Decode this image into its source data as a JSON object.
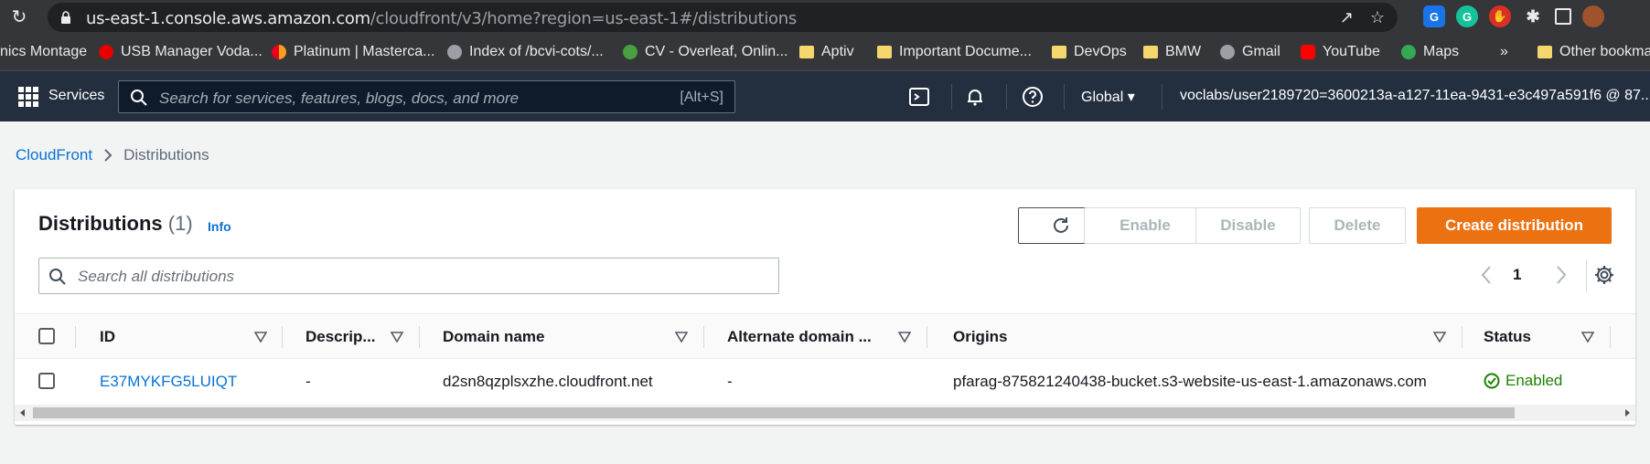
{
  "browser": {
    "url_host": "us-east-1.console.aws.amazon.com",
    "url_path": "/cloudfront/v3/home?region=us-east-1#/distributions",
    "bookmarks": [
      {
        "label": "nics Montage"
      },
      {
        "label": "USB Manager Voda..."
      },
      {
        "label": "Platinum | Masterca..."
      },
      {
        "label": "Index of /bcvi-cots/..."
      },
      {
        "label": "CV - Overleaf, Onlin..."
      },
      {
        "label": "Aptiv"
      },
      {
        "label": "Important Docume..."
      },
      {
        "label": "DevOps"
      },
      {
        "label": "BMW"
      },
      {
        "label": "Gmail"
      },
      {
        "label": "YouTube"
      },
      {
        "label": "Maps"
      },
      {
        "label": "»"
      },
      {
        "label": "Other bookmarks"
      }
    ]
  },
  "aws_nav": {
    "services": "Services",
    "search_placeholder": "Search for services, features, blogs, docs, and more",
    "search_shortcut": "[Alt+S]",
    "region": "Global",
    "account": "voclabs/user2189720=3600213a-a127-11ea-9431-e3c497a591f6 @ 87..."
  },
  "breadcrumb": {
    "root": "CloudFront",
    "current": "Distributions"
  },
  "panel": {
    "title": "Distributions",
    "count": "(1)",
    "info": "Info",
    "enable": "Enable",
    "disable": "Disable",
    "delete": "Delete",
    "create": "Create distribution",
    "search_placeholder": "Search all distributions",
    "page": "1"
  },
  "table": {
    "columns": [
      "ID",
      "Descrip...",
      "Domain name",
      "Alternate domain ...",
      "Origins",
      "Status"
    ],
    "rows": [
      {
        "id": "E37MYKFG5LUIQT",
        "description": "-",
        "domain": "d2sn8qzplsxzhe.cloudfront.net",
        "alternate": "-",
        "origins": "pfarag-875821240438-bucket.s3-website-us-east-1.amazonaws.com",
        "status": "Enabled"
      }
    ]
  },
  "colors": {
    "aws_nav": "#232f3e",
    "link": "#0972d3",
    "primary": "#ec7211",
    "success": "#1d8102"
  }
}
